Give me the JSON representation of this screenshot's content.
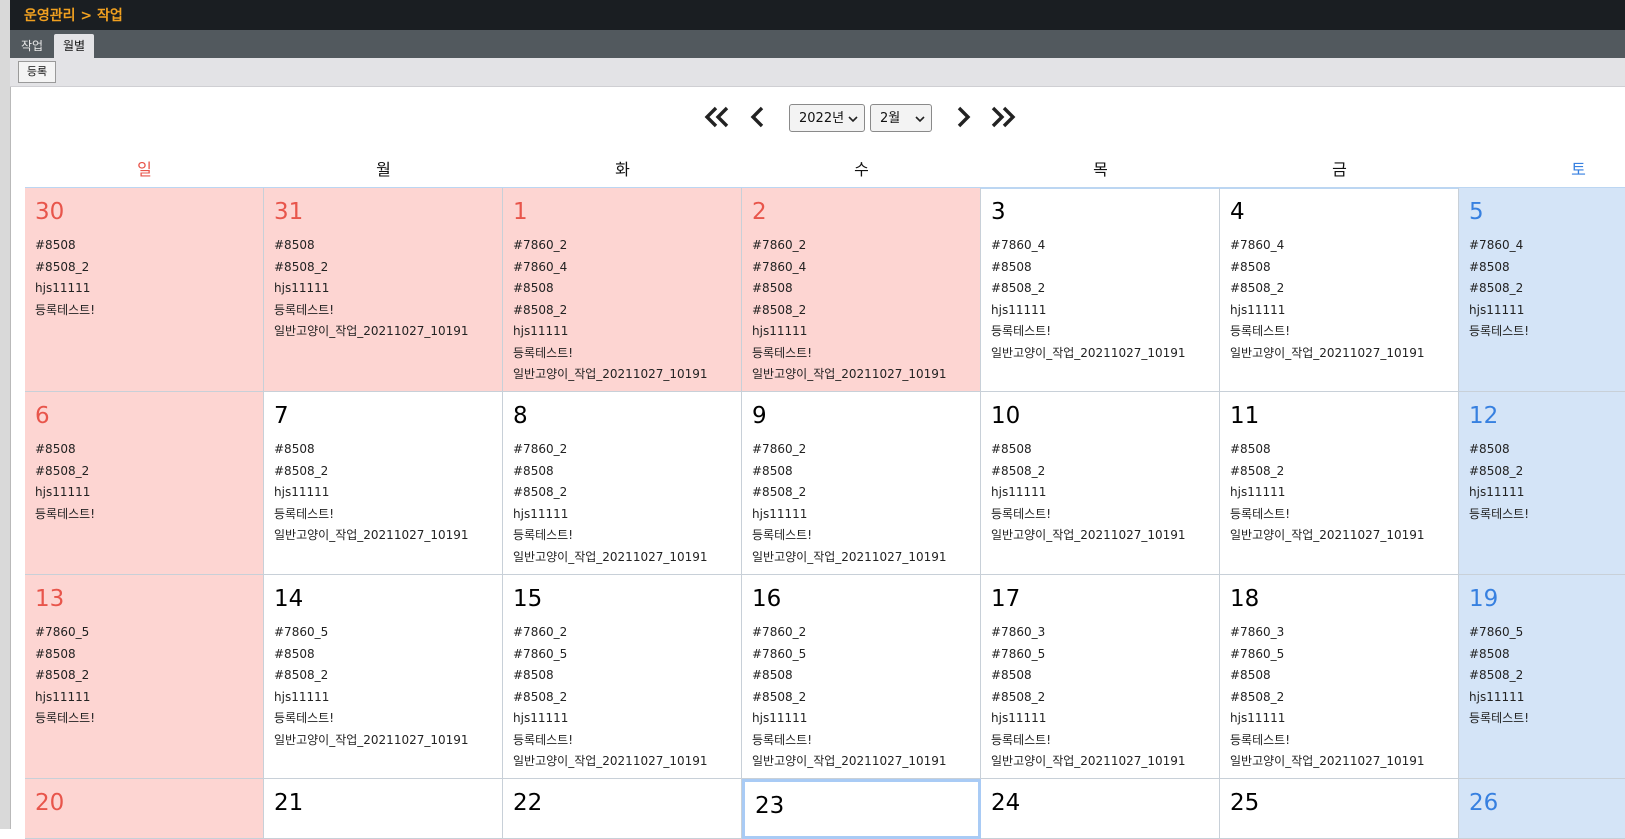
{
  "header": {
    "breadcrumb": "운영관리 > 작업"
  },
  "tabs": [
    {
      "label": "작업"
    },
    {
      "label": "월별"
    }
  ],
  "toolbar": {
    "register_label": "등록"
  },
  "nav": {
    "year": "2022년",
    "month": "2월"
  },
  "weekdays": [
    "일",
    "월",
    "화",
    "수",
    "목",
    "금",
    "토"
  ],
  "colors": {
    "holiday_bg": "#fdd5d2",
    "saturday_bg": "#d4e4f7",
    "sunday_text": "#e8554b",
    "saturday_text": "#3780e0",
    "breadcrumb": "#f0a020"
  },
  "weeks": [
    [
      {
        "day": "30",
        "items": [
          "#8508",
          "#8508_2",
          "hjs11111",
          "등록테스트!"
        ]
      },
      {
        "day": "31",
        "items": [
          "#8508",
          "#8508_2",
          "hjs11111",
          "등록테스트!",
          "일반고양이_작업_20211027_10191"
        ]
      },
      {
        "day": "1",
        "items": [
          "#7860_2",
          "#7860_4",
          "#8508",
          "#8508_2",
          "hjs11111",
          "등록테스트!",
          "일반고양이_작업_20211027_10191"
        ]
      },
      {
        "day": "2",
        "items": [
          "#7860_2",
          "#7860_4",
          "#8508",
          "#8508_2",
          "hjs11111",
          "등록테스트!",
          "일반고양이_작업_20211027_10191"
        ]
      },
      {
        "day": "3",
        "items": [
          "#7860_4",
          "#8508",
          "#8508_2",
          "hjs11111",
          "등록테스트!",
          "일반고양이_작업_20211027_10191"
        ]
      },
      {
        "day": "4",
        "items": [
          "#7860_4",
          "#8508",
          "#8508_2",
          "hjs11111",
          "등록테스트!",
          "일반고양이_작업_20211027_10191"
        ]
      },
      {
        "day": "5",
        "items": [
          "#7860_4",
          "#8508",
          "#8508_2",
          "hjs11111",
          "등록테스트!"
        ]
      }
    ],
    [
      {
        "day": "6",
        "items": [
          "#8508",
          "#8508_2",
          "hjs11111",
          "등록테스트!"
        ]
      },
      {
        "day": "7",
        "items": [
          "#8508",
          "#8508_2",
          "hjs11111",
          "등록테스트!",
          "일반고양이_작업_20211027_10191"
        ]
      },
      {
        "day": "8",
        "items": [
          "#7860_2",
          "#8508",
          "#8508_2",
          "hjs11111",
          "등록테스트!",
          "일반고양이_작업_20211027_10191"
        ]
      },
      {
        "day": "9",
        "items": [
          "#7860_2",
          "#8508",
          "#8508_2",
          "hjs11111",
          "등록테스트!",
          "일반고양이_작업_20211027_10191"
        ]
      },
      {
        "day": "10",
        "items": [
          "#8508",
          "#8508_2",
          "hjs11111",
          "등록테스트!",
          "일반고양이_작업_20211027_10191"
        ]
      },
      {
        "day": "11",
        "items": [
          "#8508",
          "#8508_2",
          "hjs11111",
          "등록테스트!",
          "일반고양이_작업_20211027_10191"
        ]
      },
      {
        "day": "12",
        "items": [
          "#8508",
          "#8508_2",
          "hjs11111",
          "등록테스트!"
        ]
      }
    ],
    [
      {
        "day": "13",
        "items": [
          "#7860_5",
          "#8508",
          "#8508_2",
          "hjs11111",
          "등록테스트!"
        ]
      },
      {
        "day": "14",
        "items": [
          "#7860_5",
          "#8508",
          "#8508_2",
          "hjs11111",
          "등록테스트!",
          "일반고양이_작업_20211027_10191"
        ]
      },
      {
        "day": "15",
        "items": [
          "#7860_2",
          "#7860_5",
          "#8508",
          "#8508_2",
          "hjs11111",
          "등록테스트!",
          "일반고양이_작업_20211027_10191"
        ]
      },
      {
        "day": "16",
        "items": [
          "#7860_2",
          "#7860_5",
          "#8508",
          "#8508_2",
          "hjs11111",
          "등록테스트!",
          "일반고양이_작업_20211027_10191"
        ]
      },
      {
        "day": "17",
        "items": [
          "#7860_3",
          "#7860_5",
          "#8508",
          "#8508_2",
          "hjs11111",
          "등록테스트!",
          "일반고양이_작업_20211027_10191"
        ]
      },
      {
        "day": "18",
        "items": [
          "#7860_3",
          "#7860_5",
          "#8508",
          "#8508_2",
          "hjs11111",
          "등록테스트!",
          "일반고양이_작업_20211027_10191"
        ]
      },
      {
        "day": "19",
        "items": [
          "#7860_5",
          "#8508",
          "#8508_2",
          "hjs11111",
          "등록테스트!"
        ]
      }
    ],
    [
      {
        "day": "20",
        "items": []
      },
      {
        "day": "21",
        "items": []
      },
      {
        "day": "22",
        "items": []
      },
      {
        "day": "23",
        "items": []
      },
      {
        "day": "24",
        "items": []
      },
      {
        "day": "25",
        "items": []
      },
      {
        "day": "26",
        "items": []
      }
    ]
  ]
}
